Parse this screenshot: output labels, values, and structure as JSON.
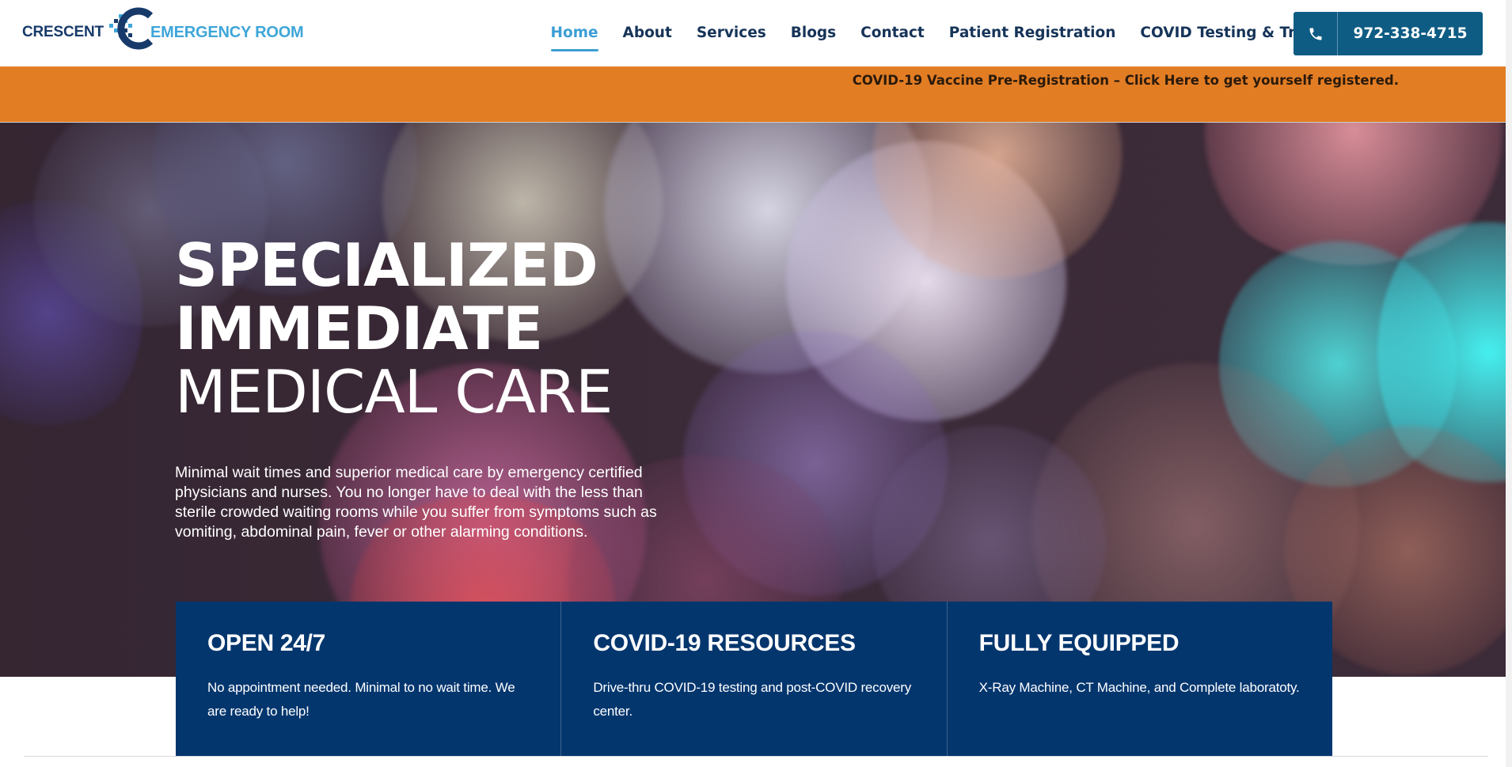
{
  "logo": {
    "word_left": "CRESCENT",
    "word_right": "EMERGENCY ROOM",
    "colors": {
      "dark": "#173a6a",
      "light": "#3ea6d8"
    }
  },
  "nav": {
    "items": [
      {
        "label": "Home",
        "active": true
      },
      {
        "label": "About",
        "active": false
      },
      {
        "label": "Services",
        "active": false
      },
      {
        "label": "Blogs",
        "active": false
      },
      {
        "label": "Contact",
        "active": false
      },
      {
        "label": "Patient Registration",
        "active": false
      },
      {
        "label": "COVID Testing & Treatment",
        "active": false
      }
    ],
    "phone": {
      "icon": "phone-icon",
      "number": "972-338-4715"
    }
  },
  "announcement": {
    "text": "COVID-19 Vaccine Pre-Registration – Click Here to get yourself registered.",
    "background": "#e27d24"
  },
  "hero": {
    "title_line1": "SPECIALIZED",
    "title_line2": "IMMEDIATE",
    "title_line3": "MEDICAL CARE",
    "description": "Minimal wait times and superior medical care by emergency certified physicians and nurses. You no longer have to deal with the less than sterile crowded waiting rooms while you suffer from symptoms such as vomiting, abdominal pain, fever or other alarming conditions."
  },
  "features": [
    {
      "title": "OPEN 24/7",
      "text": "No appointment needed. Minimal to no wait time. We are ready to help!"
    },
    {
      "title": "COVID-19 RESOURCES",
      "text": "Drive-thru COVID-19 testing and post-COVID recovery center."
    },
    {
      "title": "FULLY EQUIPPED",
      "text": "X-Ray Machine, CT Machine, and Complete laboratoty."
    }
  ],
  "colors": {
    "nav_text": "#163459",
    "nav_active": "#3c9ed5",
    "phone_button": "#0e5c84",
    "feature_panel": "#04366e"
  }
}
